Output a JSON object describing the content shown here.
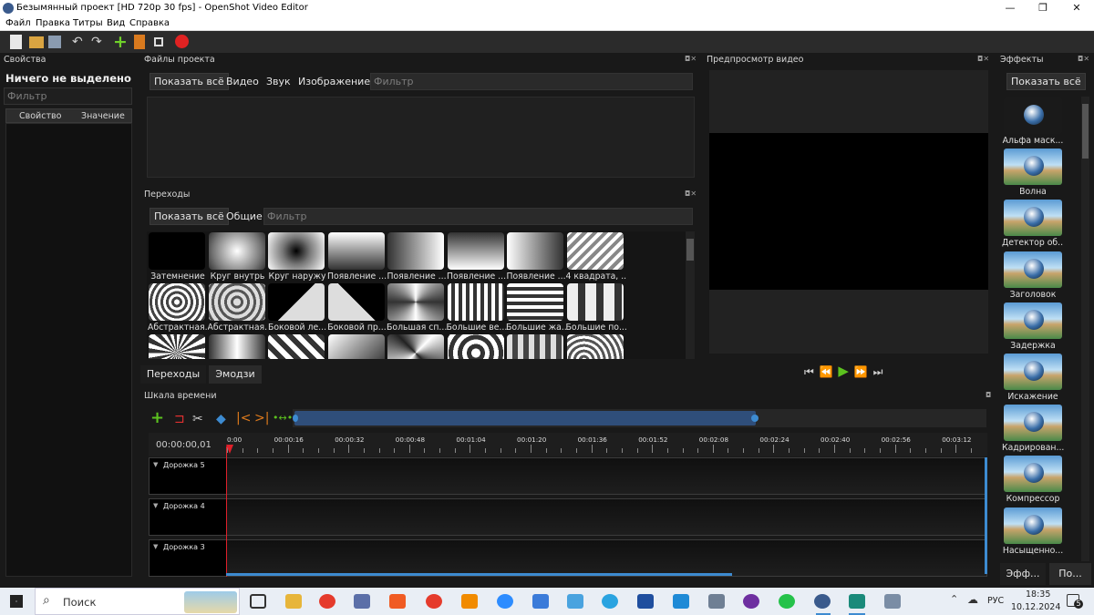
{
  "window": {
    "title": "Безымянный проект [HD 720p 30 fps] - OpenShot Video Editor",
    "minimize": "—",
    "maximize": "❐",
    "close": "✕"
  },
  "menu": [
    "Файл",
    "Правка",
    "Титры",
    "Вид",
    "Справка"
  ],
  "toolbar": [
    "new-project-icon",
    "open-project-icon",
    "save-project-icon",
    "undo-icon",
    "redo-icon",
    "import-files-icon",
    "profile-icon",
    "fullscreen-icon",
    "record-icon"
  ],
  "properties": {
    "title": "Свойства",
    "nothing_selected": "Ничего не выделено",
    "filter_placeholder": "Фильтр",
    "col_property": "Свойство",
    "col_value": "Значение"
  },
  "project_files": {
    "title": "Файлы проекта",
    "tabs": [
      "Показать всё",
      "Видео",
      "Звук",
      "Изображение"
    ],
    "filter_placeholder": "Фильтр"
  },
  "transitions": {
    "title": "Переходы",
    "tabs": [
      "Показать всё",
      "Общие"
    ],
    "filter_placeholder": "Фильтр",
    "items": [
      "Затемнение",
      "Круг внутрь",
      "Круг наружу",
      "Появление ...",
      "Появление ...",
      "Появление ...",
      "Появление ...",
      "4 квадрата, ...",
      "Абстрактная...",
      "Абстрактная...",
      "Боковой ле...",
      "Боковой пр...",
      "Большая сп...",
      "Большие ве...",
      "Большие жа...",
      "Большие по...",
      "",
      "",
      "",
      "",
      "",
      "",
      "",
      ""
    ],
    "bottom_tabs": [
      "Переходы",
      "Эмодзи"
    ]
  },
  "preview": {
    "title": "Предпросмотр видео"
  },
  "effects": {
    "title": "Эффекты",
    "show_all": "Показать всё",
    "items": [
      "Альфа маск...",
      "Волна",
      "Детектор об...",
      "Заголовок",
      "Задержка",
      "Искажение",
      "Кадрирован...",
      "Компрессор",
      "Насыщенно..."
    ],
    "bottom_tabs": [
      "Эфф...",
      "По..."
    ]
  },
  "timeline": {
    "title": "Шкала времени",
    "timecode": "00:00:00,01",
    "ticks": [
      "0:00",
      "00:00:16",
      "00:00:32",
      "00:00:48",
      "00:01:04",
      "00:01:20",
      "00:01:36",
      "00:01:52",
      "00:02:08",
      "00:02:24",
      "00:02:40",
      "00:02:56",
      "00:03:12"
    ],
    "tracks": [
      "Дорожка 5",
      "Дорожка 4",
      "Дорожка 3"
    ]
  },
  "taskbar": {
    "search": "Поиск",
    "lang": "РУС",
    "time": "18:35",
    "date": "10.12.2024",
    "notifications": "5"
  },
  "colors": {
    "accent": "#3d8bd1",
    "playhead": "#e0202a",
    "green": "#5cc21f"
  }
}
